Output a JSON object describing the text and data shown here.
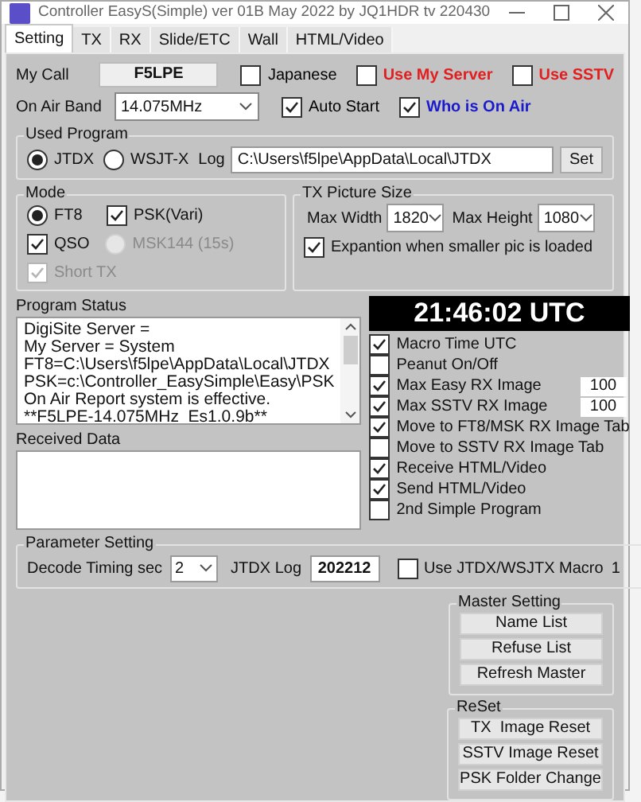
{
  "window": {
    "title": "Controller EasyS(Simple) ver 01B May 2022 by JQ1HDR tv 220430"
  },
  "tabs": [
    {
      "label": "Setting",
      "selected": true
    },
    {
      "label": "TX",
      "selected": false
    },
    {
      "label": "RX",
      "selected": false
    },
    {
      "label": "Slide/ETC",
      "selected": false
    },
    {
      "label": "Wall",
      "selected": false
    },
    {
      "label": "HTML/Video",
      "selected": false
    }
  ],
  "my_call": {
    "label": "My Call",
    "value": "F5LPE"
  },
  "on_air_band": {
    "label": "On Air Band",
    "value": "14.075MHz"
  },
  "top_options": [
    {
      "label": "Japanese",
      "checked": false,
      "color": "#000000"
    },
    {
      "label": "Use My Server",
      "checked": false,
      "color": "#e02020"
    },
    {
      "label": "Use SSTV",
      "checked": false,
      "color": "#e02020"
    },
    {
      "label": "Auto Start",
      "checked": true,
      "color": "#000000"
    },
    {
      "label": "Who is On Air",
      "checked": true,
      "color": "#1a1acc"
    }
  ],
  "used_program": {
    "title": "Used Program",
    "options": [
      {
        "label": "JTDX",
        "selected": true
      },
      {
        "label": "WSJT-X",
        "selected": false
      }
    ],
    "log_label": "Log",
    "log_path": "C:\\Users\\f5lpe\\AppData\\Local\\JTDX",
    "set_button": "Set"
  },
  "mode": {
    "title": "Mode",
    "options": [
      {
        "kind": "radio",
        "label": "FT8",
        "checked": true,
        "disabled": false
      },
      {
        "kind": "checkbox",
        "label": "PSK(Vari)",
        "checked": true,
        "disabled": false
      },
      {
        "kind": "checkbox",
        "label": "QSO",
        "checked": true,
        "disabled": false
      },
      {
        "kind": "radio",
        "label": "MSK144 (15s)",
        "checked": false,
        "disabled": true
      },
      {
        "kind": "checkbox",
        "label": "Short TX",
        "checked": true,
        "disabled": true
      }
    ]
  },
  "tx_picture_size": {
    "title": "TX Picture Size",
    "max_width": {
      "label": "Max Width",
      "value": "1820"
    },
    "max_height": {
      "label": "Max Height",
      "value": "1080"
    },
    "expansion": {
      "label": "Expantion when smaller pic is loaded",
      "checked": true
    }
  },
  "program_status": {
    "title": "Program Status",
    "lines": [
      "DigiSite Server =",
      "My Server = System",
      "FT8=C:\\Users\\f5lpe\\AppData\\Local\\JTDX",
      "PSK=c:\\Controller_EasySimple\\Easy\\PSK",
      "On Air Report system is effective.",
      "**F5LPE-14.075MHz  Es1.0.9b**"
    ]
  },
  "clock": "21:46:02 UTC",
  "received_data": {
    "title": "Received Data"
  },
  "options": [
    {
      "label": "Macro Time UTC",
      "checked": true
    },
    {
      "label": "Peanut On/Off",
      "checked": false
    },
    {
      "label": "Max Easy RX Image",
      "checked": true,
      "value": "100"
    },
    {
      "label": "Max SSTV RX Image",
      "checked": true,
      "value": "100"
    },
    {
      "label": "Move to FT8/MSK RX Image Tab",
      "checked": true
    },
    {
      "label": "Move to SSTV RX Image Tab",
      "checked": false
    },
    {
      "label": "Receive HTML/Video",
      "checked": true
    },
    {
      "label": "Send HTML/Video",
      "checked": true
    },
    {
      "label": "2nd Simple Program",
      "checked": false
    }
  ],
  "parameter_setting": {
    "title": "Parameter Setting",
    "decode_timing": {
      "label": "Decode Timing sec",
      "value": "2"
    },
    "jtdx_log": {
      "label": "JTDX Log",
      "value": "202212"
    },
    "macro": {
      "label": "Use JTDX/WSJTX Macro",
      "checked": false
    },
    "count": "1"
  },
  "master_setting": {
    "title": "Master Setting",
    "buttons": [
      "Name List",
      "Refuse List",
      "Refresh Master"
    ]
  },
  "reset": {
    "title": "ReSet",
    "buttons": [
      "TX  Image Reset",
      "SSTV Image Reset",
      "PSK Folder Change"
    ]
  }
}
